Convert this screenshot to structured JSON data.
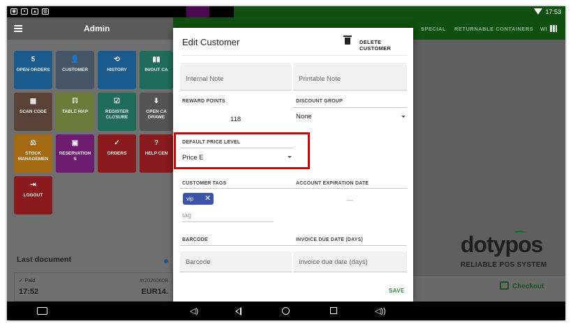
{
  "status_bar": {
    "time": "17:53"
  },
  "top_bar": {
    "title": "Admin",
    "categories": [
      "SPECIAL",
      "RETURNABLE CONTAINERS",
      "WI"
    ]
  },
  "tiles": [
    {
      "icon_text": "5",
      "label": "OPEN ORDERS",
      "icon": "number-badge",
      "color": "#1a5a8c"
    },
    {
      "icon_text": "👤",
      "label": "CUSTOMER",
      "icon": "person-icon",
      "color": "#465566"
    },
    {
      "icon_text": "⟲",
      "label": "HISTORY",
      "icon": "history-icon",
      "color": "#1a5a8c"
    },
    {
      "icon_text": "▮▮",
      "label": "IN/OUT CA",
      "icon": "cash-icon",
      "color": "#1f6b5c"
    },
    {
      "icon_text": "▦",
      "label": "SCAN CODE",
      "icon": "qr-icon",
      "color": "#5a4236"
    },
    {
      "icon_text": "ℿ",
      "label": "TABLE MAP",
      "icon": "table-icon",
      "color": "#6b7b3a"
    },
    {
      "icon_text": "☑",
      "label": "REGISTER CLOSURE",
      "icon": "register-closure-icon",
      "color": "#1f6b5c"
    },
    {
      "icon_text": "⬇",
      "label": "OPEN CA DRAWE",
      "icon": "drawer-icon",
      "color": "#545454"
    },
    {
      "icon_text": "⚖",
      "label": "STOCK MANAGEMEN",
      "icon": "stock-icon",
      "color": "#a36a12"
    },
    {
      "icon_text": "▣",
      "label": "RESERVATION S",
      "icon": "calendar-icon",
      "color": "#6c1b6e"
    },
    {
      "icon_text": "✓",
      "label": "ORDERS",
      "icon": "check-icon",
      "color": "#8a1a1e"
    },
    {
      "icon_text": "?",
      "label": "HELP CEN",
      "icon": "help-icon",
      "color": "#8a1a1e"
    },
    {
      "icon_text": "⇥",
      "label": "LOGOUT",
      "icon": "logout-icon",
      "color": "#8a1a1e"
    }
  ],
  "last_document": {
    "heading": "Last document",
    "status": "✓ Paid",
    "number": "#r2026060B",
    "time": "17:52",
    "amount": "EUR14."
  },
  "brand": {
    "logo": "dotypos",
    "tagline": "RELIABLE POS SYSTEM"
  },
  "checkout_label": "Checkout",
  "dialog": {
    "title": "Edit Customer",
    "delete_label": "DELETE CUSTOMER",
    "internal_note_placeholder": "Internal Note",
    "printable_note_placeholder": "Printable Note",
    "reward_points_label": "REWARD POINTS",
    "reward_points_value": "118",
    "discount_group_label": "DISCOUNT GROUP",
    "discount_group_value": "None",
    "price_level_label": "DEFAULT PRICE LEVEL",
    "price_level_value": "Price E",
    "customer_tags_label": "CUSTOMER TAGS",
    "tag_chip": "vip",
    "tag_placeholder": "tag",
    "expiration_label": "ACCOUNT EXPIRATION DATE",
    "expiration_value": "—",
    "barcode_label": "BARCODE",
    "barcode_placeholder": "Barcode",
    "invoice_due_label": "INVOICE DUE DATE (DAYS)",
    "invoice_due_placeholder": "Invoice due date (days)",
    "save_label": "SAVE"
  },
  "colors": {
    "highlight": "#d40000",
    "accent_green": "#2e8b3a",
    "chip_blue": "#3b53a8"
  }
}
